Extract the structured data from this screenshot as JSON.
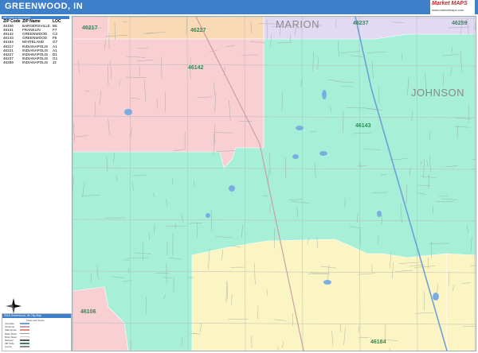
{
  "title": "GREENWOOD, IN",
  "logo": {
    "brand": "Market MAPS",
    "sub": "www.marketmaps.com"
  },
  "zip_table": {
    "header": "ZIP Codes in Greenwood",
    "columns": [
      "ZIP Code",
      "ZIP Name",
      "LOC"
    ],
    "rows": [
      [
        "46106",
        "BARGERSVILLE",
        "B5"
      ],
      [
        "46131",
        "FRANKLIN",
        "F7"
      ],
      [
        "46142",
        "GREENWOOD",
        "C3"
      ],
      [
        "46143",
        "GREENWOOD",
        "F5"
      ],
      [
        "46184",
        "WHITELAND",
        "G7"
      ],
      [
        "46217",
        "INDIANAPOLIS",
        "A1"
      ],
      [
        "46221",
        "INDIANAPOLIS",
        "A1"
      ],
      [
        "46227",
        "INDIANAPOLIS",
        "D1"
      ],
      [
        "46237",
        "INDIANAPOLIS",
        "G1"
      ],
      [
        "46259",
        "INDIANAPOLIS",
        "J2"
      ]
    ]
  },
  "map": {
    "counties": [
      "MARION",
      "JOHNSON"
    ],
    "zip_labels": [
      "46217",
      "46227",
      "46237",
      "46259",
      "46142",
      "46143",
      "46106",
      "46184"
    ],
    "colors": {
      "pink": "#f8cfd3",
      "mint": "#a8efd8",
      "yellow": "#fbf5c4",
      "orange": "#fad9b5",
      "lavender": "#e2d9f3",
      "water": "#7aaee0",
      "road": "#c9a0a8",
      "highway": "#6f9fd6",
      "zip_text": "#2e8b57"
    }
  },
  "legend": {
    "title": "2016 Greenwood, IN City Map",
    "subtitle": "Cities and Towns",
    "items": [
      "Interstate",
      "US Route",
      "State Route",
      "Major Road",
      "Minor Road",
      "Railroad",
      "ZIP Code",
      "County"
    ]
  }
}
